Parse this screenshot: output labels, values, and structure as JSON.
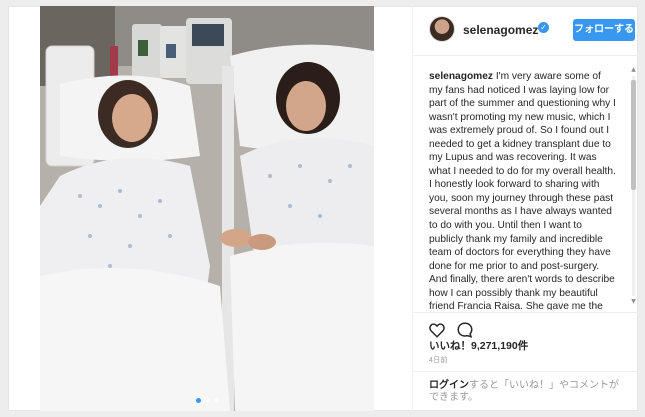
{
  "post": {
    "username": "selenagomez",
    "follow_label": "フォローする",
    "caption_user": "selenagomez",
    "caption_text": "I'm very aware some of my fans had noticed I was laying low for part of the summer and questioning why I wasn't promoting my new music, which I was extremely proud of. So I found out I needed to get a kidney transplant due to my Lupus and was recovering. It was what I needed to do for my overall health. I honestly look forward to sharing with you, soon my journey through these past several months as I have always wanted to do with you. Until then I want to publicly thank my family and incredible team of doctors for everything they have done for me prior to and post-surgery. And finally, there aren't words to describe how I can possibly thank my beautiful friend Francia Raisa. She gave me the ultimate gift and sacrifice by donating her kidney to me. I am incredibly blessed. I love you so much sis.",
    "likes_label": "いいね！9,271,190件",
    "time_label": "4日前",
    "login_link": "ログイン",
    "login_rest": "すると「いいね！」やコメントができます。"
  },
  "icons": {
    "verified": "verified-badge-icon",
    "like": "heart-icon",
    "comment": "comment-bubble-icon"
  },
  "colors": {
    "accent": "#3897f0",
    "text": "#262626",
    "muted": "#999999"
  },
  "carousel": {
    "count": 3,
    "active": 1
  }
}
